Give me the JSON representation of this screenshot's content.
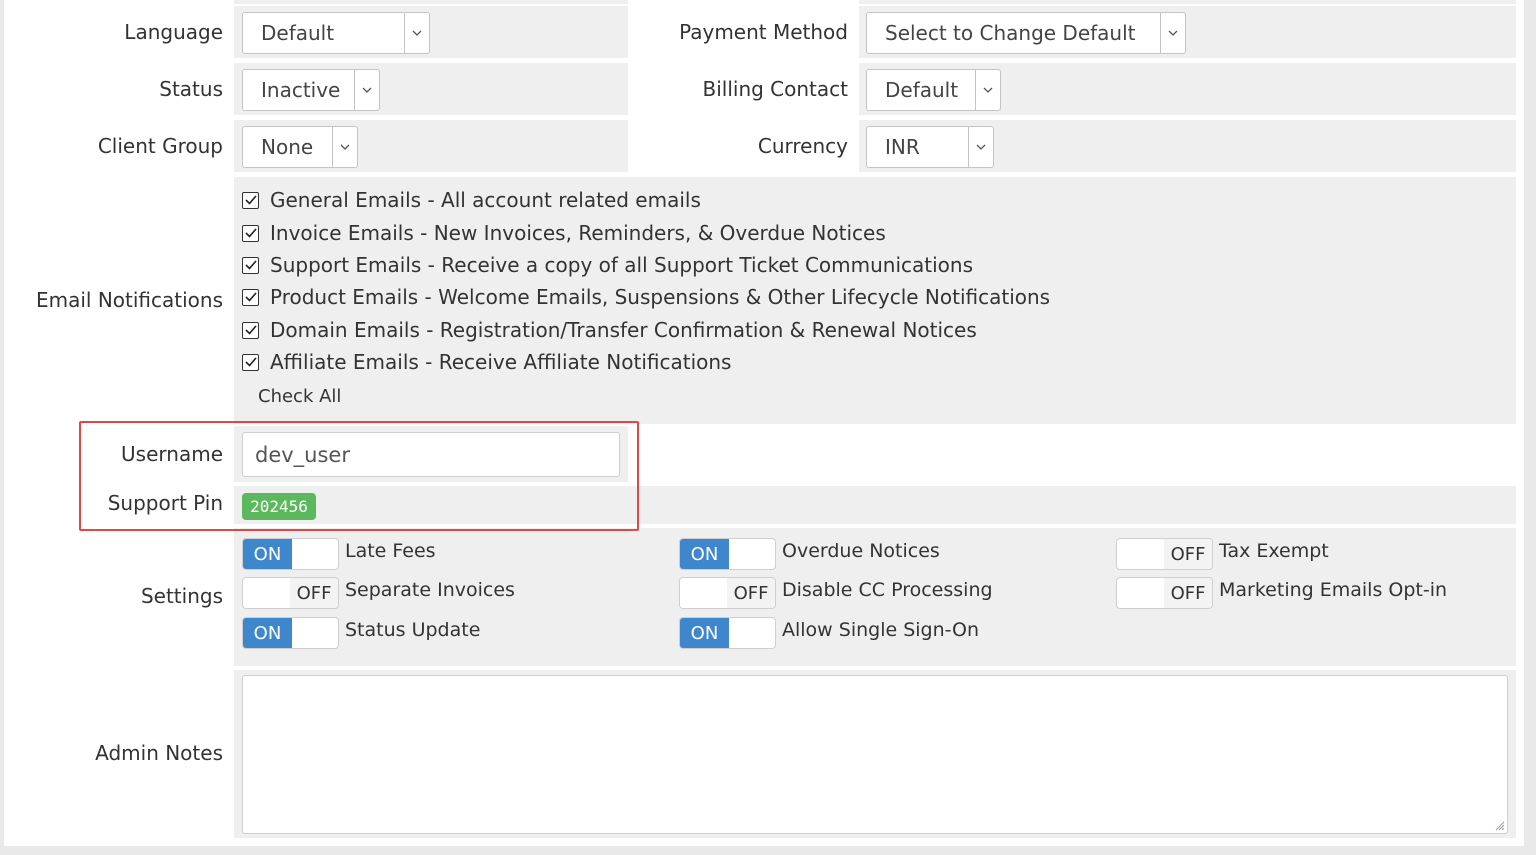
{
  "fields": {
    "language": {
      "label": "Language",
      "value": "Default"
    },
    "payment_method": {
      "label": "Payment Method",
      "value": "Select to Change Default"
    },
    "status": {
      "label": "Status",
      "value": "Inactive"
    },
    "billing_contact": {
      "label": "Billing Contact",
      "value": "Default"
    },
    "client_group": {
      "label": "Client Group",
      "value": "None"
    },
    "currency": {
      "label": "Currency",
      "value": "INR"
    }
  },
  "email_notifications": {
    "label": "Email Notifications",
    "items": [
      {
        "text": "General Emails - All account related emails",
        "checked": true
      },
      {
        "text": "Invoice Emails - New Invoices, Reminders, & Overdue Notices",
        "checked": true
      },
      {
        "text": "Support Emails - Receive a copy of all Support Ticket Communications",
        "checked": true
      },
      {
        "text": "Product Emails - Welcome Emails, Suspensions & Other Lifecycle Notifications",
        "checked": true
      },
      {
        "text": "Domain Emails - Registration/Transfer Confirmation & Renewal Notices",
        "checked": true
      },
      {
        "text": "Affiliate Emails - Receive Affiliate Notifications",
        "checked": true
      }
    ],
    "check_all": "Check All"
  },
  "username": {
    "label": "Username",
    "value": "dev_user"
  },
  "support_pin": {
    "label": "Support Pin",
    "value": "202456",
    "color": "#5cb85c"
  },
  "settings": {
    "label": "Settings",
    "on_text": "ON",
    "off_text": "OFF",
    "toggles": [
      {
        "label": "Late Fees",
        "state": "on"
      },
      {
        "label": "Overdue Notices",
        "state": "on"
      },
      {
        "label": "Tax Exempt",
        "state": "off"
      },
      {
        "label": "Separate Invoices",
        "state": "off"
      },
      {
        "label": "Disable CC Processing",
        "state": "off"
      },
      {
        "label": "Marketing Emails Opt-in",
        "state": "off"
      },
      {
        "label": "Status Update",
        "state": "on"
      },
      {
        "label": "Allow Single Sign-On",
        "state": "on"
      }
    ]
  },
  "admin_notes": {
    "label": "Admin Notes",
    "value": ""
  },
  "colors": {
    "toggle_on": "#3f87cc",
    "highlight_border": "#e04848",
    "field_bg": "#efefef"
  }
}
